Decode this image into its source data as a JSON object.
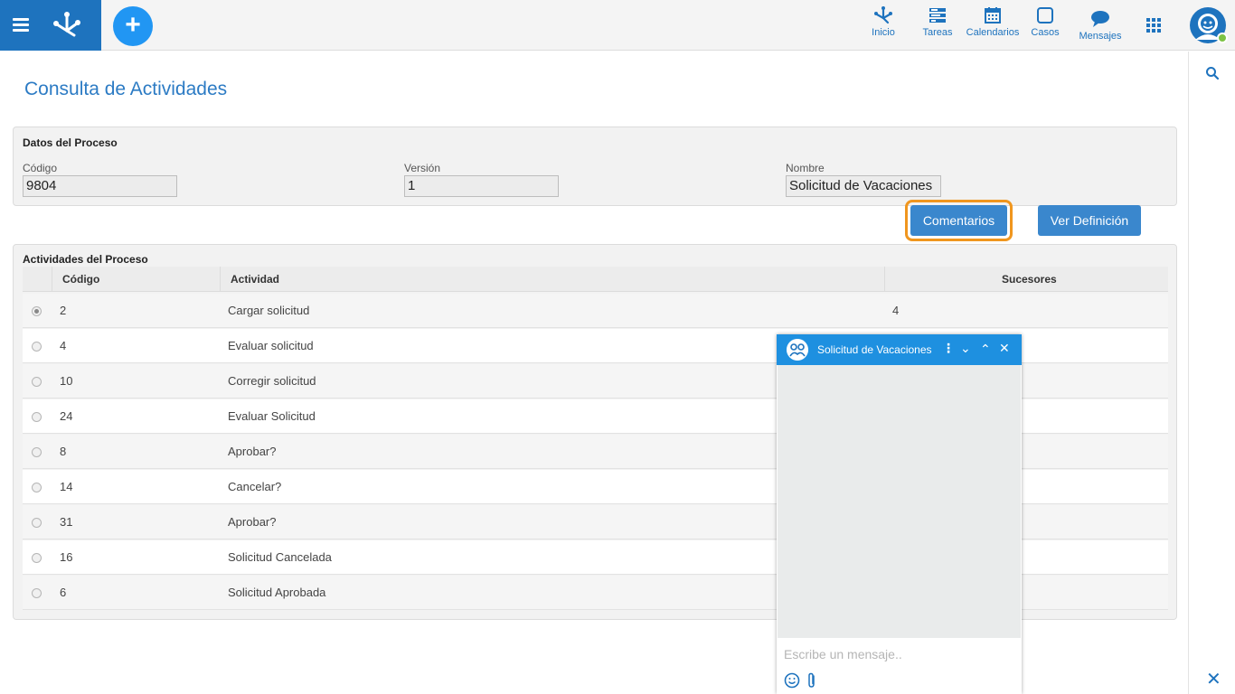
{
  "nav": {
    "items": [
      {
        "label": "Inicio",
        "icon": "home-flow-icon"
      },
      {
        "label": "Tareas",
        "icon": "tasks-icon"
      },
      {
        "label": "Calendarios",
        "icon": "calendar-icon"
      },
      {
        "label": "Casos",
        "icon": "cases-icon"
      },
      {
        "label": "Mensajes",
        "icon": "messages-icon"
      }
    ]
  },
  "page": {
    "title": "Consulta de Actividades"
  },
  "datos": {
    "title": "Datos del Proceso",
    "codigo_label": "Código",
    "codigo_value": "9804",
    "version_label": "Versión",
    "version_value": "1",
    "nombre_label": "Nombre",
    "nombre_value": "Solicitud de Vacaciones"
  },
  "buttons": {
    "comentarios": "Comentarios",
    "ver_definicion": "Ver Definición"
  },
  "actividades": {
    "title": "Actividades del Proceso",
    "columns": [
      "Código",
      "Actividad",
      "Sucesores"
    ],
    "rows": [
      {
        "codigo": "2",
        "actividad": "Cargar solicitud",
        "sucesores": "4",
        "selected": true
      },
      {
        "codigo": "4",
        "actividad": "Evaluar solicitud",
        "sucesores": ""
      },
      {
        "codigo": "10",
        "actividad": "Corregir solicitud",
        "sucesores": ""
      },
      {
        "codigo": "24",
        "actividad": "Evaluar Solicitud",
        "sucesores": ""
      },
      {
        "codigo": "8",
        "actividad": "Aprobar?",
        "sucesores": ""
      },
      {
        "codigo": "14",
        "actividad": "Cancelar?",
        "sucesores": ""
      },
      {
        "codigo": "31",
        "actividad": "Aprobar?",
        "sucesores": ""
      },
      {
        "codigo": "16",
        "actividad": "Solicitud Cancelada",
        "sucesores": ""
      },
      {
        "codigo": "6",
        "actividad": "Solicitud Aprobada",
        "sucesores": ""
      }
    ]
  },
  "chat": {
    "title": "Solicitud de Vacaciones",
    "placeholder": "Escribe un mensaje.."
  },
  "colors": {
    "brand": "#1e73be",
    "button": "#3a87cd",
    "highlight": "#f0961e",
    "chat_header": "#1e90e0"
  }
}
